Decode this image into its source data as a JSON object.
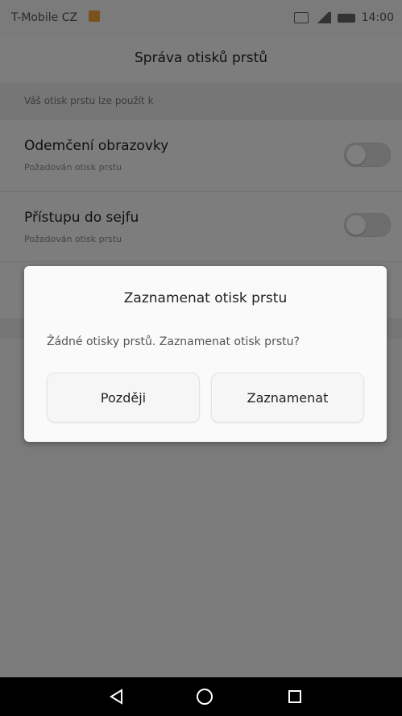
{
  "status_bar": {
    "carrier": "T-Mobile CZ",
    "time": "14:00",
    "icons": [
      "notification-icon",
      "sim-icon",
      "signal-icon",
      "battery-icon"
    ]
  },
  "app_bar": {
    "title": "Správa otisků prstů"
  },
  "section": {
    "header": "Váš otisk prstu lze použít k"
  },
  "settings": {
    "items": [
      {
        "title": "Odemčení obrazovky",
        "subtitle": "Požadován otisk prstu",
        "enabled": false
      },
      {
        "title": "Přístupu do sejfu",
        "subtitle": "Požadován otisk prstu",
        "enabled": false
      }
    ]
  },
  "dialog": {
    "title": "Zaznamenat otisk prstu",
    "message": "Žádné otisky prstů. Zaznamenat otisk prstu?",
    "buttons": {
      "later": "Později",
      "record": "Zaznamenat"
    }
  },
  "nav_bar": {
    "icons": [
      "back-icon",
      "home-icon",
      "recent-apps-icon"
    ]
  },
  "colors": {
    "scrim": "#000000",
    "dialog_bg": "#fafafa",
    "accent": "#f2a23a"
  }
}
